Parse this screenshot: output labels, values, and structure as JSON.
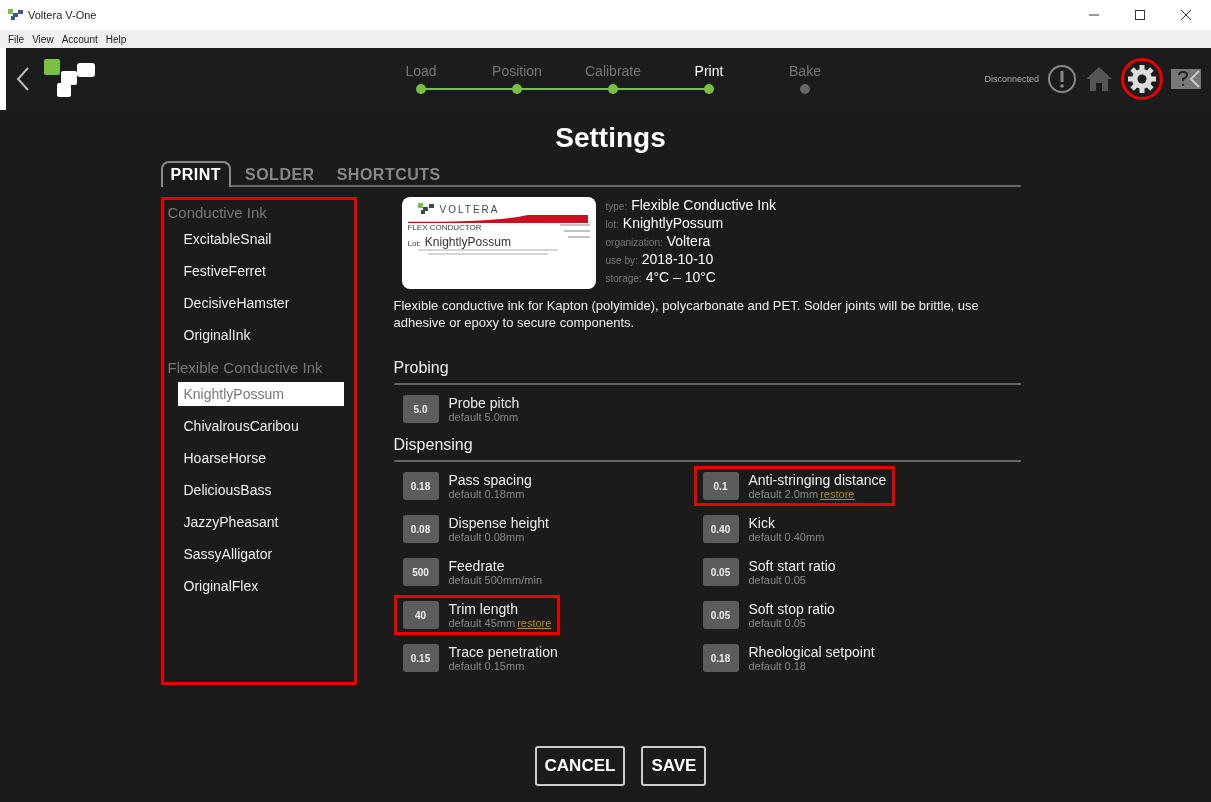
{
  "window": {
    "title": "Voltera V-One"
  },
  "menu": [
    "File",
    "View",
    "Account",
    "Help"
  ],
  "steps": [
    {
      "label": "Load",
      "done": true,
      "selected": false
    },
    {
      "label": "Position",
      "done": true,
      "selected": false
    },
    {
      "label": "Calibrate",
      "done": true,
      "selected": false
    },
    {
      "label": "Print",
      "done": true,
      "selected": true
    },
    {
      "label": "Bake",
      "done": false,
      "selected": false
    }
  ],
  "connection": "Disconnected",
  "settings_button": {
    "highlighted": true
  },
  "dialog": {
    "title": "Settings",
    "tabs": [
      {
        "label": "PRINT",
        "selected": true
      },
      {
        "label": "SOLDER",
        "selected": false
      },
      {
        "label": "SHORTCUTS",
        "selected": false
      }
    ],
    "ink_list": {
      "highlighted": true,
      "groups": [
        {
          "name": "Conductive Ink",
          "items": [
            {
              "label": "ExcitableSnail",
              "selected": false
            },
            {
              "label": "FestiveFerret",
              "selected": false
            },
            {
              "label": "DecisiveHamster",
              "selected": false
            },
            {
              "label": "OriginalInk",
              "selected": false
            }
          ]
        },
        {
          "name": "Flexible Conductive Ink",
          "items": [
            {
              "label": "KnightlyPossum",
              "selected": true
            },
            {
              "label": "ChivalrousCaribou",
              "selected": false
            },
            {
              "label": "HoarseHorse",
              "selected": false
            },
            {
              "label": "DeliciousBass",
              "selected": false
            },
            {
              "label": "JazzyPheasant",
              "selected": false
            },
            {
              "label": "SassyAlligator",
              "selected": false
            },
            {
              "label": "OriginalFlex",
              "selected": false
            }
          ]
        }
      ]
    },
    "ink_label": {
      "brand": "VOLTERA",
      "product": "FLEX CONDUCTOR",
      "lot_caption": "Lot:",
      "lot": "KnightlyPossum"
    },
    "ink_info": [
      {
        "label": "type:",
        "value": "Flexible Conductive Ink"
      },
      {
        "label": "lot:",
        "value": "KnightlyPossum"
      },
      {
        "label": "organization:",
        "value": "Voltera"
      },
      {
        "label": "use by:",
        "value": "2018-10-10"
      },
      {
        "label": "storage:",
        "value": "4°C – 10°C"
      }
    ],
    "description": "Flexible conductive ink for Kapton (polyimide), polycarbonate and PET. Solder joints will be brittle, use adhesive or epoxy to secure components.",
    "sections": [
      {
        "title": "Probing",
        "columns": [
          [
            {
              "value": "5.0",
              "name": "Probe pitch",
              "default": "default 5.0mm",
              "highlighted": false
            }
          ]
        ]
      },
      {
        "title": "Dispensing",
        "columns": [
          [
            {
              "value": "0.18",
              "name": "Pass spacing",
              "default": "default 0.18mm",
              "highlighted": false
            },
            {
              "value": "0.08",
              "name": "Dispense height",
              "default": "default 0.08mm",
              "highlighted": false
            },
            {
              "value": "500",
              "name": "Feedrate",
              "default": "default 500mm/min",
              "highlighted": false
            },
            {
              "value": "40",
              "name": "Trim length",
              "default": "default 45mm",
              "restore": "restore",
              "highlighted": true
            },
            {
              "value": "0.15",
              "name": "Trace penetration",
              "default": "default 0.15mm",
              "highlighted": false
            }
          ],
          [
            {
              "value": "0.1",
              "name": "Anti-stringing distance",
              "default": "default 2.0mm",
              "restore": "restore",
              "highlighted": true
            },
            {
              "value": "0.40",
              "name": "Kick",
              "default": "default 0.40mm",
              "highlighted": false
            },
            {
              "value": "0.05",
              "name": "Soft start ratio",
              "default": "default 0.05",
              "highlighted": false
            },
            {
              "value": "0.05",
              "name": "Soft stop ratio",
              "default": "default 0.05",
              "highlighted": false
            },
            {
              "value": "0.18",
              "name": "Rheological setpoint",
              "default": "default 0.18",
              "highlighted": false
            }
          ]
        ]
      }
    ],
    "buttons": [
      "CANCEL",
      "SAVE"
    ]
  }
}
